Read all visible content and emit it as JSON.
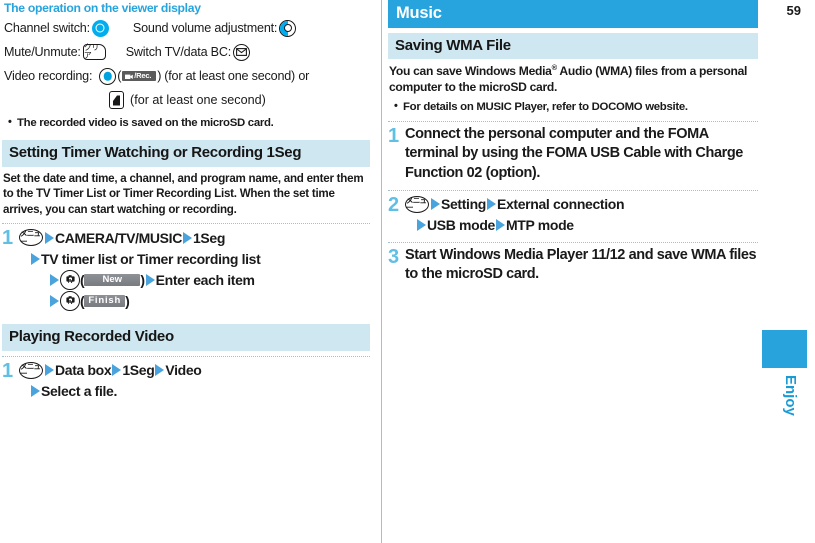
{
  "page": {
    "number": "59",
    "side_tab_label": "Enjoy"
  },
  "left_column": {
    "viewer_display": {
      "title": "The operation on the viewer display",
      "rows": [
        {
          "label": "Channel switch:",
          "icon": "4way-ring-key-icon",
          "label2": "Sound volume adjustment:",
          "icon2": "4way-half-ring-key-icon"
        },
        {
          "label": "Mute/Unmute:",
          "icon": "clear-key-icon",
          "icon_text": "クリア",
          "label2": "Switch TV/data BC:",
          "icon2": "mail-key-icon"
        }
      ],
      "video_recording_label": "Video recording:",
      "video_recording_center_key": "center-key-icon",
      "video_recording_paren_open": "(",
      "video_recording_button": "/Rec.",
      "video_recording_paren_close": ")",
      "video_recording_suffix": "(for at least one second) or",
      "video_recording_softkey": "softkey-icon",
      "video_recording_sub_suffix": "(for at least one second)",
      "note": "The recorded video is saved on the microSD card."
    },
    "section_timer": {
      "heading": "Setting Timer Watching or Recording 1Seg",
      "body": "Set the date and time, a channel, and program name, and enter them to the TV Timer List or Timer Recording List. When the set time arrives, you can start watching or recording.",
      "steps": [
        {
          "num": "1",
          "lines": [
            {
              "menu_key": "メニュー",
              "parts": [
                "CAMERA/TV/MUSIC",
                "1Seg"
              ]
            },
            {
              "parts": [
                "TV timer list or Timer recording list"
              ]
            },
            {
              "cam_key": "TV",
              "paren_open": "(",
              "button": "New",
              "paren_close": ")",
              "parts": [
                "Enter each item"
              ]
            },
            {
              "cam_key": "TV",
              "paren_open": "(",
              "button": "Finish",
              "paren_close": ")"
            }
          ]
        }
      ]
    },
    "section_playing": {
      "heading": "Playing Recorded Video",
      "steps": [
        {
          "num": "1",
          "lines": [
            {
              "menu_key": "メニュー",
              "parts": [
                "Data box",
                "1Seg",
                "Video"
              ]
            },
            {
              "parts": [
                "Select a file."
              ]
            }
          ]
        }
      ]
    }
  },
  "right_column": {
    "chapter_heading": "Music",
    "section_heading": "Saving WMA File",
    "intro": "You can save Windows Media® Audio (WMA) files from a personal computer to the microSD card.",
    "note": "For details on MUSIC Player, refer to DOCOMO website.",
    "steps": [
      {
        "num": "1",
        "text": "Connect the personal computer and the FOMA terminal by using the FOMA USB Cable with Charge Function 02 (option)."
      },
      {
        "num": "2",
        "menu_key": "メニュー",
        "parts": [
          "Setting",
          "External connection"
        ],
        "parts2": [
          "USB mode",
          "MTP mode"
        ]
      },
      {
        "num": "3",
        "text": "Start Windows Media Player 11/12 and save WMA files to the microSD card."
      }
    ]
  },
  "colors": {
    "accent_blue": "#27a4dd",
    "light_blue_bg": "#cfe7f0",
    "step_num_blue": "#5fbfe4",
    "arrow_blue": "#4aa3dd",
    "key_cyan": "#00aeef"
  }
}
